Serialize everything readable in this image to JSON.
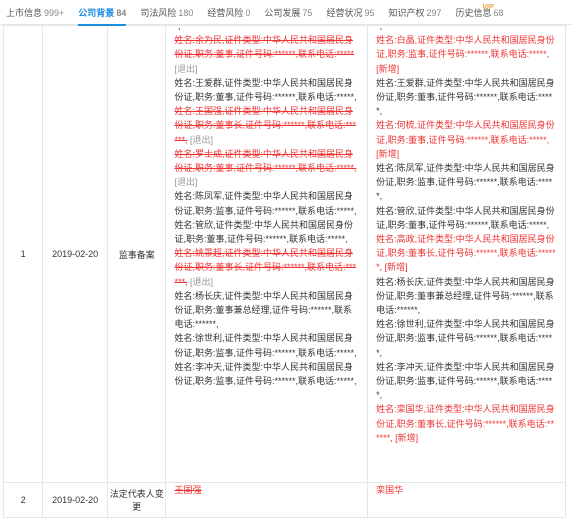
{
  "tabs": [
    {
      "label": "上市信息",
      "count": "999+"
    },
    {
      "label": "公司背景",
      "count": "84",
      "active": true
    },
    {
      "label": "司法风险",
      "count": "180"
    },
    {
      "label": "经营风险",
      "count": "0"
    },
    {
      "label": "公司发展",
      "count": "75"
    },
    {
      "label": "经营状况",
      "count": "95"
    },
    {
      "label": "知识产权",
      "count": "297"
    },
    {
      "label": "历史信息",
      "count": "68"
    }
  ],
  "vip_badge": "VIP",
  "rows": [
    {
      "no": "1",
      "date": "2019-02-20",
      "type": "监事备案",
      "before": [
        {
          "text": "*,",
          "style": "plain"
        },
        {
          "text": "姓名:余为民,证件类型:中华人民共和国居民身份证,职务:董事,证件号码:******,联系电话:*****",
          "style": "del",
          "tag": "[退出]"
        },
        {
          "text": "姓名:王爱群,证件类型:中华人民共和国居民身份证,职务:董事,证件号码:******,联系电话:*****,",
          "style": "plain"
        },
        {
          "text": "姓名:王国强,证件类型:中华人民共和国居民身份证,职务:董事长,证件号码:******,联系电话:******,",
          "style": "del",
          "tag": "[退出]"
        },
        {
          "text": "姓名:罗士成,证件类型:中华人民共和国居民身份证,职务:董事,证件号码:******,联系电话:*****,",
          "style": "del",
          "tag": "[退出]"
        },
        {
          "text": "姓名:陈凤军,证件类型:中华人民共和国居民身份证,职务:监事,证件号码:******,联系电话:*****,",
          "style": "plain"
        },
        {
          "text": "姓名:管欣,证件类型:中华人民共和国居民身份证,职务:董事,证件号码:******,联系电话:*****,",
          "style": "plain"
        },
        {
          "text": "姓名:姚景超,证件类型:中华人民共和国居民身份证,职务:董事长,证件号码:******,联系电话:******,",
          "style": "del",
          "tag": "[退出]"
        },
        {
          "text": "姓名:杨长庆,证件类型:中华人民共和国居民身份证,职务:董事兼总经理,证件号码:******,联系电话:******,",
          "style": "plain"
        },
        {
          "text": "姓名:徐世利,证件类型:中华人民共和国居民身份证,职务:监事,证件号码:******,联系电话:*****,",
          "style": "plain"
        },
        {
          "text": "姓名:李冲天,证件类型:中华人民共和国居民身份证,职务:监事,证件号码:******,联系电话:*****,",
          "style": "plain"
        }
      ],
      "after": [
        {
          "text": "*,",
          "style": "plain"
        },
        {
          "text": "姓名:白晶,证件类型:中华人民共和国居民身份证,职务:监事,证件号码:******,联系电话:*****,",
          "style": "new",
          "tag": "[新增]"
        },
        {
          "text": "姓名:王爱群,证件类型:中华人民共和国居民身份证,职务:董事,证件号码:******,联系电话:*****,",
          "style": "plain"
        },
        {
          "text": "姓名:何梳,证件类型:中华人民共和国居民身份证,职务:董事,证件号码:******,联系电话:*****,",
          "style": "new",
          "tag": "[新增]"
        },
        {
          "text": "姓名:陈凤军,证件类型:中华人民共和国居民身份证,职务:监事,证件号码:******,联系电话:*****,",
          "style": "plain"
        },
        {
          "text": "姓名:管欣,证件类型:中华人民共和国居民身份证,职务:董事,证件号码:******,联系电话:*****,",
          "style": "plain"
        },
        {
          "text": "姓名:高政,证件类型:中华人民共和国居民身份证,职务:董事长,证件号码:******,联系电话:******,",
          "style": "new",
          "tag": "[新增]"
        },
        {
          "text": "姓名:杨长庆,证件类型:中华人民共和国居民身份证,职务:董事兼总经理,证件号码:******,联系电话:******,",
          "style": "plain"
        },
        {
          "text": "姓名:徐世利,证件类型:中华人民共和国居民身份证,职务:监事,证件号码:******,联系电话:*****,",
          "style": "plain"
        },
        {
          "text": "姓名:李冲天,证件类型:中华人民共和国居民身份证,职务:监事,证件号码:******,联系电话:*****,",
          "style": "plain"
        },
        {
          "text": "姓名:栾国华,证件类型:中华人民共和国居民身份证,职务:董事长,证件号码:******,联系电话:******,",
          "style": "new",
          "tag": "[新增]"
        }
      ]
    },
    {
      "no": "2",
      "date": "2019-02-20",
      "type": "法定代表人变更",
      "before_text": "王国强",
      "after_text": "栾国华"
    }
  ]
}
